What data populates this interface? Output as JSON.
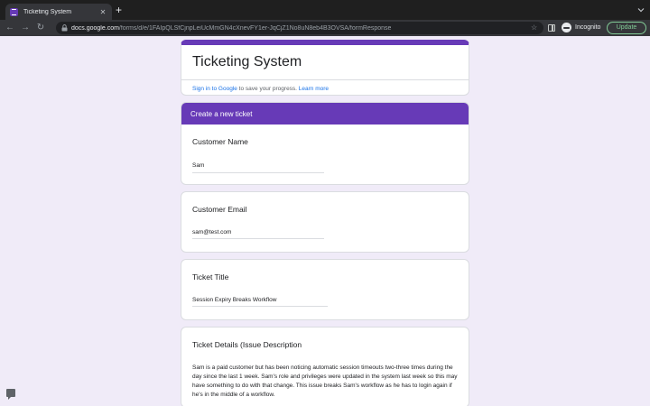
{
  "browser": {
    "tab": {
      "title": "Ticketing System",
      "close": "✕"
    },
    "new_tab": "+",
    "nav": {
      "back": "←",
      "forward": "→",
      "reload": "↻"
    },
    "address": {
      "host": "docs.google.com",
      "path": "/forms/d/e/1FAIpQLSfCjnpLeiUcMmGN4cXnevFY1er-JqCjZ1No8uN8eb4B3OVSA/formResponse"
    },
    "star": "☆",
    "incognito_label": "Incognito",
    "update_label": "Update"
  },
  "form": {
    "title": "Ticketing System",
    "signin": {
      "link": "Sign in to Google",
      "text": " to save your progress. ",
      "learn_more": "Learn more"
    },
    "section_title": "Create a new ticket",
    "questions": [
      {
        "label": "Customer Name",
        "answer": "Sam"
      },
      {
        "label": "Customer Email",
        "answer": "sam@test.com"
      },
      {
        "label": "Ticket Title",
        "answer": "Session Expiry Breaks Workflow"
      },
      {
        "label": "Ticket Details (Issue Description",
        "answer": "Sam is a paid customer but has been noticing automatic session timeouts two-three times during the day since the last 1 week. Sam's role and privileges were updated in the system last week so this may have something to do with that change. This issue breaks Sam's workflow as he has to login again if he's in the middle of a workflow."
      }
    ]
  },
  "colors": {
    "accent": "#673ab7",
    "page_bg": "#f0ebf8",
    "link": "#1a73e8"
  },
  "icons": [
    "tab-favicon",
    "close-icon",
    "plus-icon",
    "back-arrow-icon",
    "forward-arrow-icon",
    "reload-icon",
    "lock-icon",
    "star-icon",
    "side-panel-icon",
    "incognito-icon",
    "feedback-icon"
  ]
}
